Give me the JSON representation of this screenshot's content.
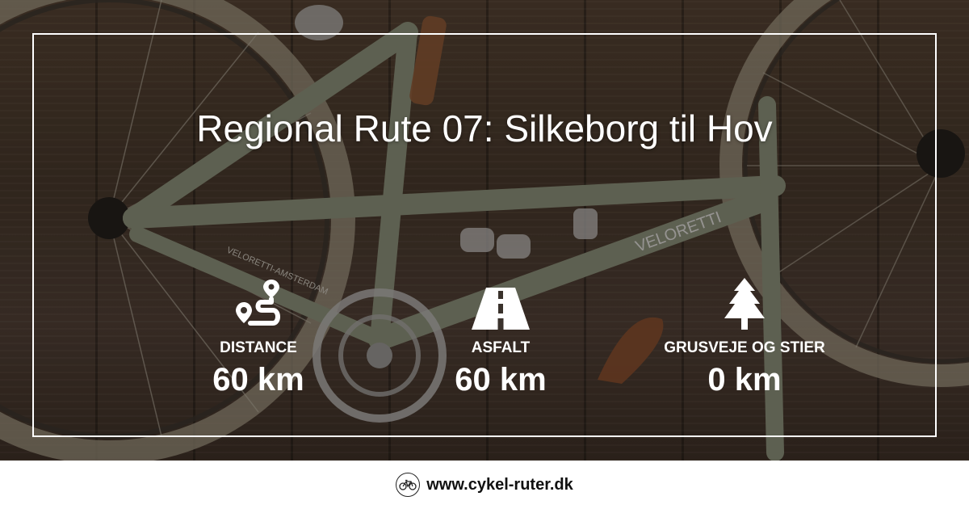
{
  "title": "Regional Rute 07: Silkeborg til Hov",
  "stats": [
    {
      "icon": "route-icon",
      "label": "DISTANCE",
      "value": "60 km"
    },
    {
      "icon": "road-icon",
      "label": "ASFALT",
      "value": "60 km"
    },
    {
      "icon": "tree-icon",
      "label": "GRUSVEJE OG STIER",
      "value": "0 km"
    }
  ],
  "footer": {
    "logo_icon": "bicycle-icon",
    "site": "www.cykel-ruter.dk"
  },
  "background_image": {
    "frame_lettering": [
      "VELORETTI",
      "VELORETTI-AMSTERDAM"
    ]
  },
  "colors": {
    "text": "#ffffff",
    "footer_bg": "#ffffff",
    "footer_text": "#111111"
  }
}
